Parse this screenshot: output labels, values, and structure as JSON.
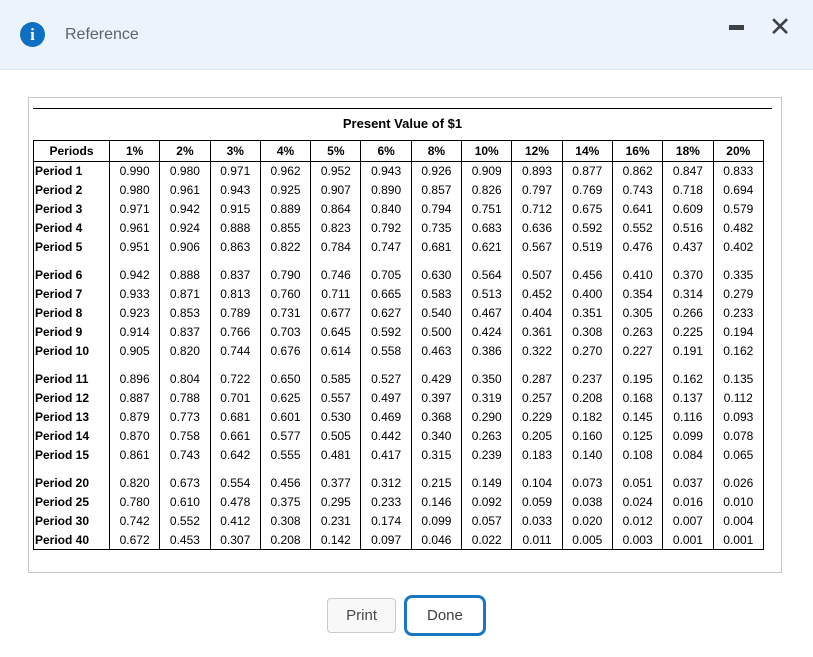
{
  "window": {
    "title": "Reference",
    "info_icon_glyph": "i",
    "close_glyph": "✕"
  },
  "colors": {
    "titlebar_bg": "#edf3fc",
    "info_icon_blue": "#0d6fc1",
    "done_border_blue": "#1a76c2",
    "table_border": "#000000"
  },
  "buttons": {
    "print": "Print",
    "done": "Done"
  },
  "table": {
    "title": "Present Value of $1",
    "headers": [
      "Periods",
      "1%",
      "2%",
      "3%",
      "4%",
      "5%",
      "6%",
      "8%",
      "10%",
      "12%",
      "14%",
      "16%",
      "18%",
      "20%"
    ],
    "groups": [
      [
        {
          "label": "Period 1",
          "values": [
            "0.990",
            "0.980",
            "0.971",
            "0.962",
            "0.952",
            "0.943",
            "0.926",
            "0.909",
            "0.893",
            "0.877",
            "0.862",
            "0.847",
            "0.833"
          ]
        },
        {
          "label": "Period 2",
          "values": [
            "0.980",
            "0.961",
            "0.943",
            "0.925",
            "0.907",
            "0.890",
            "0.857",
            "0.826",
            "0.797",
            "0.769",
            "0.743",
            "0.718",
            "0.694"
          ]
        },
        {
          "label": "Period 3",
          "values": [
            "0.971",
            "0.942",
            "0.915",
            "0.889",
            "0.864",
            "0.840",
            "0.794",
            "0.751",
            "0.712",
            "0.675",
            "0.641",
            "0.609",
            "0.579"
          ]
        },
        {
          "label": "Period 4",
          "values": [
            "0.961",
            "0.924",
            "0.888",
            "0.855",
            "0.823",
            "0.792",
            "0.735",
            "0.683",
            "0.636",
            "0.592",
            "0.552",
            "0.516",
            "0.482"
          ]
        },
        {
          "label": "Period 5",
          "values": [
            "0.951",
            "0.906",
            "0.863",
            "0.822",
            "0.784",
            "0.747",
            "0.681",
            "0.621",
            "0.567",
            "0.519",
            "0.476",
            "0.437",
            "0.402"
          ]
        }
      ],
      [
        {
          "label": "Period 6",
          "values": [
            "0.942",
            "0.888",
            "0.837",
            "0.790",
            "0.746",
            "0.705",
            "0.630",
            "0.564",
            "0.507",
            "0.456",
            "0.410",
            "0.370",
            "0.335"
          ]
        },
        {
          "label": "Period 7",
          "values": [
            "0.933",
            "0.871",
            "0.813",
            "0.760",
            "0.711",
            "0.665",
            "0.583",
            "0.513",
            "0.452",
            "0.400",
            "0.354",
            "0.314",
            "0.279"
          ]
        },
        {
          "label": "Period 8",
          "values": [
            "0.923",
            "0.853",
            "0.789",
            "0.731",
            "0.677",
            "0.627",
            "0.540",
            "0.467",
            "0.404",
            "0.351",
            "0.305",
            "0.266",
            "0.233"
          ]
        },
        {
          "label": "Period 9",
          "values": [
            "0.914",
            "0.837",
            "0.766",
            "0.703",
            "0.645",
            "0.592",
            "0.500",
            "0.424",
            "0.361",
            "0.308",
            "0.263",
            "0.225",
            "0.194"
          ]
        },
        {
          "label": "Period 10",
          "values": [
            "0.905",
            "0.820",
            "0.744",
            "0.676",
            "0.614",
            "0.558",
            "0.463",
            "0.386",
            "0.322",
            "0.270",
            "0.227",
            "0.191",
            "0.162"
          ]
        }
      ],
      [
        {
          "label": "Period 11",
          "values": [
            "0.896",
            "0.804",
            "0.722",
            "0.650",
            "0.585",
            "0.527",
            "0.429",
            "0.350",
            "0.287",
            "0.237",
            "0.195",
            "0.162",
            "0.135"
          ]
        },
        {
          "label": "Period 12",
          "values": [
            "0.887",
            "0.788",
            "0.701",
            "0.625",
            "0.557",
            "0.497",
            "0.397",
            "0.319",
            "0.257",
            "0.208",
            "0.168",
            "0.137",
            "0.112"
          ]
        },
        {
          "label": "Period 13",
          "values": [
            "0.879",
            "0.773",
            "0.681",
            "0.601",
            "0.530",
            "0.469",
            "0.368",
            "0.290",
            "0.229",
            "0.182",
            "0.145",
            "0.116",
            "0.093"
          ]
        },
        {
          "label": "Period 14",
          "values": [
            "0.870",
            "0.758",
            "0.661",
            "0.577",
            "0.505",
            "0.442",
            "0.340",
            "0.263",
            "0.205",
            "0.160",
            "0.125",
            "0.099",
            "0.078"
          ]
        },
        {
          "label": "Period 15",
          "values": [
            "0.861",
            "0.743",
            "0.642",
            "0.555",
            "0.481",
            "0.417",
            "0.315",
            "0.239",
            "0.183",
            "0.140",
            "0.108",
            "0.084",
            "0.065"
          ]
        }
      ],
      [
        {
          "label": "Period 20",
          "values": [
            "0.820",
            "0.673",
            "0.554",
            "0.456",
            "0.377",
            "0.312",
            "0.215",
            "0.149",
            "0.104",
            "0.073",
            "0.051",
            "0.037",
            "0.026"
          ]
        },
        {
          "label": "Period 25",
          "values": [
            "0.780",
            "0.610",
            "0.478",
            "0.375",
            "0.295",
            "0.233",
            "0.146",
            "0.092",
            "0.059",
            "0.038",
            "0.024",
            "0.016",
            "0.010"
          ]
        },
        {
          "label": "Period 30",
          "values": [
            "0.742",
            "0.552",
            "0.412",
            "0.308",
            "0.231",
            "0.174",
            "0.099",
            "0.057",
            "0.033",
            "0.020",
            "0.012",
            "0.007",
            "0.004"
          ]
        },
        {
          "label": "Period 40",
          "values": [
            "0.672",
            "0.453",
            "0.307",
            "0.208",
            "0.142",
            "0.097",
            "0.046",
            "0.022",
            "0.011",
            "0.005",
            "0.003",
            "0.001",
            "0.001"
          ]
        }
      ]
    ]
  }
}
